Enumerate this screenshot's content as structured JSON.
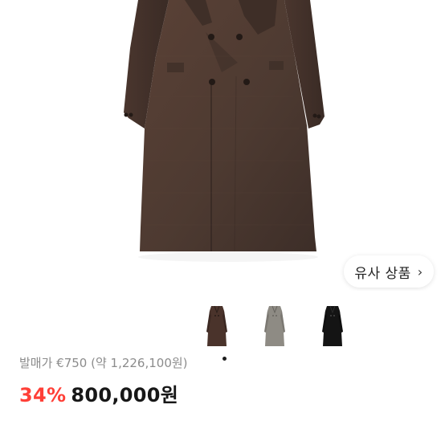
{
  "similar_products": {
    "label": "유사 상품",
    "icon": "chevron-right-icon"
  },
  "gallery": {
    "selected_index": 0,
    "thumbnails": [
      {
        "color_name": "brown"
      },
      {
        "color_name": "gray"
      },
      {
        "color_name": "black"
      }
    ]
  },
  "pricing": {
    "retail_label": "발매가 €750 (약 1,226,100원)",
    "discount": "34%",
    "price": "800,000원"
  },
  "colors": {
    "accent": "#ff3f37",
    "coat_brown": "#4a332b",
    "coat_gray": "#8e8b84",
    "coat_black": "#141414"
  }
}
